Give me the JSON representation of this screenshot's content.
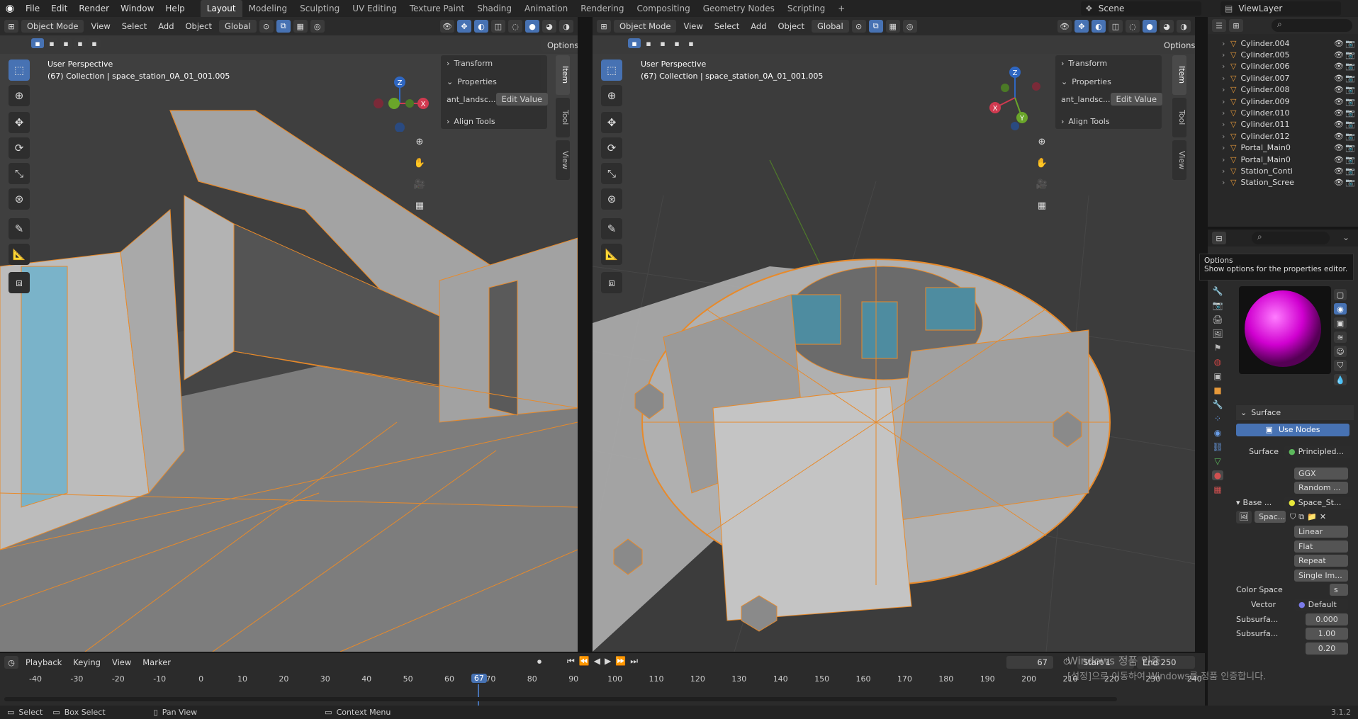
{
  "menu": {
    "file": "File",
    "edit": "Edit",
    "render": "Render",
    "window": "Window",
    "help": "Help"
  },
  "workspaces": [
    "Layout",
    "Modeling",
    "Sculpting",
    "UV Editing",
    "Texture Paint",
    "Shading",
    "Animation",
    "Rendering",
    "Compositing",
    "Geometry Nodes",
    "Scripting"
  ],
  "add_workspace": "+",
  "scene": "Scene",
  "view_layer": "ViewLayer",
  "viewport_header": {
    "mode": "Object Mode",
    "view": "View",
    "select": "Select",
    "add": "Add",
    "object": "Object",
    "orientation": "Global",
    "options": "Options"
  },
  "viewport_left": {
    "perspective": "User Perspective",
    "collection": "(67) Collection | space_station_0A_01_001.005"
  },
  "viewport_right": {
    "perspective": "User Perspective",
    "collection": "(67) Collection | space_station_0A_01_001.005"
  },
  "npanel": {
    "transform": "Transform",
    "properties": "Properties",
    "prop_name": "ant_landsc...",
    "edit_value": "Edit Value",
    "align_tools": "Align Tools",
    "tab_item": "Item",
    "tab_tool": "Tool",
    "tab_view": "View"
  },
  "gizmo": {
    "x": "X",
    "y": "Y",
    "z": "Z"
  },
  "outliner": [
    "Cylinder.004",
    "Cylinder.005",
    "Cylinder.006",
    "Cylinder.007",
    "Cylinder.008",
    "Cylinder.009",
    "Cylinder.010",
    "Cylinder.011",
    "Cylinder.012",
    "Portal_Main0",
    "Portal_Main0",
    "Station_Conti",
    "Station_Scree"
  ],
  "tooltip": {
    "title": "Options",
    "body": "Show options for the properties editor."
  },
  "properties": {
    "surface_header": "Surface",
    "use_nodes": "Use Nodes",
    "surface_label": "Surface",
    "surface_value": "Principled...",
    "ggx": "GGX",
    "random": "Random ...",
    "base_label": "Base ...",
    "base_value": "Space_St...",
    "image_name": "Spac...",
    "linear": "Linear",
    "flat": "Flat",
    "repeat": "Repeat",
    "single_image": "Single Im...",
    "color_space_label": "Color Space",
    "color_space_value": "s",
    "vector_label": "Vector",
    "vector_value": "Default",
    "subsurf1_label": "Subsurfa...",
    "subsurf1_value": "0.000",
    "subsurf2_label": "Subsurfa...",
    "subsurf2_value": "1.00",
    "subsurf2_value2": "0.20"
  },
  "timeline": {
    "playback": "Playback",
    "keying": "Keying",
    "view": "View",
    "marker": "Marker",
    "current_frame": "67",
    "start_label": "Start",
    "start_value": "1",
    "end_label": "End",
    "end_value": "250",
    "ticks": [
      "-40",
      "-30",
      "-20",
      "-10",
      "0",
      "10",
      "20",
      "30",
      "40",
      "50",
      "60",
      "70",
      "80",
      "90",
      "100",
      "110",
      "120",
      "130",
      "140",
      "150",
      "160",
      "170",
      "180",
      "190",
      "200",
      "210",
      "220",
      "230",
      "240"
    ],
    "playhead": "67"
  },
  "watermark": {
    "line1": "Windows 정품 인증",
    "line2": "[설정]으로 이동하여 Windows를 정품 인증합니다."
  },
  "statusbar": {
    "select": "Select",
    "box_select": "Box Select",
    "pan_view": "Pan View",
    "context_menu": "Context Menu",
    "version": "3.1.2"
  },
  "colors": {
    "accent": "#4772b3",
    "selection_outline": "#e88a2a",
    "playhead": "#4772b3"
  }
}
